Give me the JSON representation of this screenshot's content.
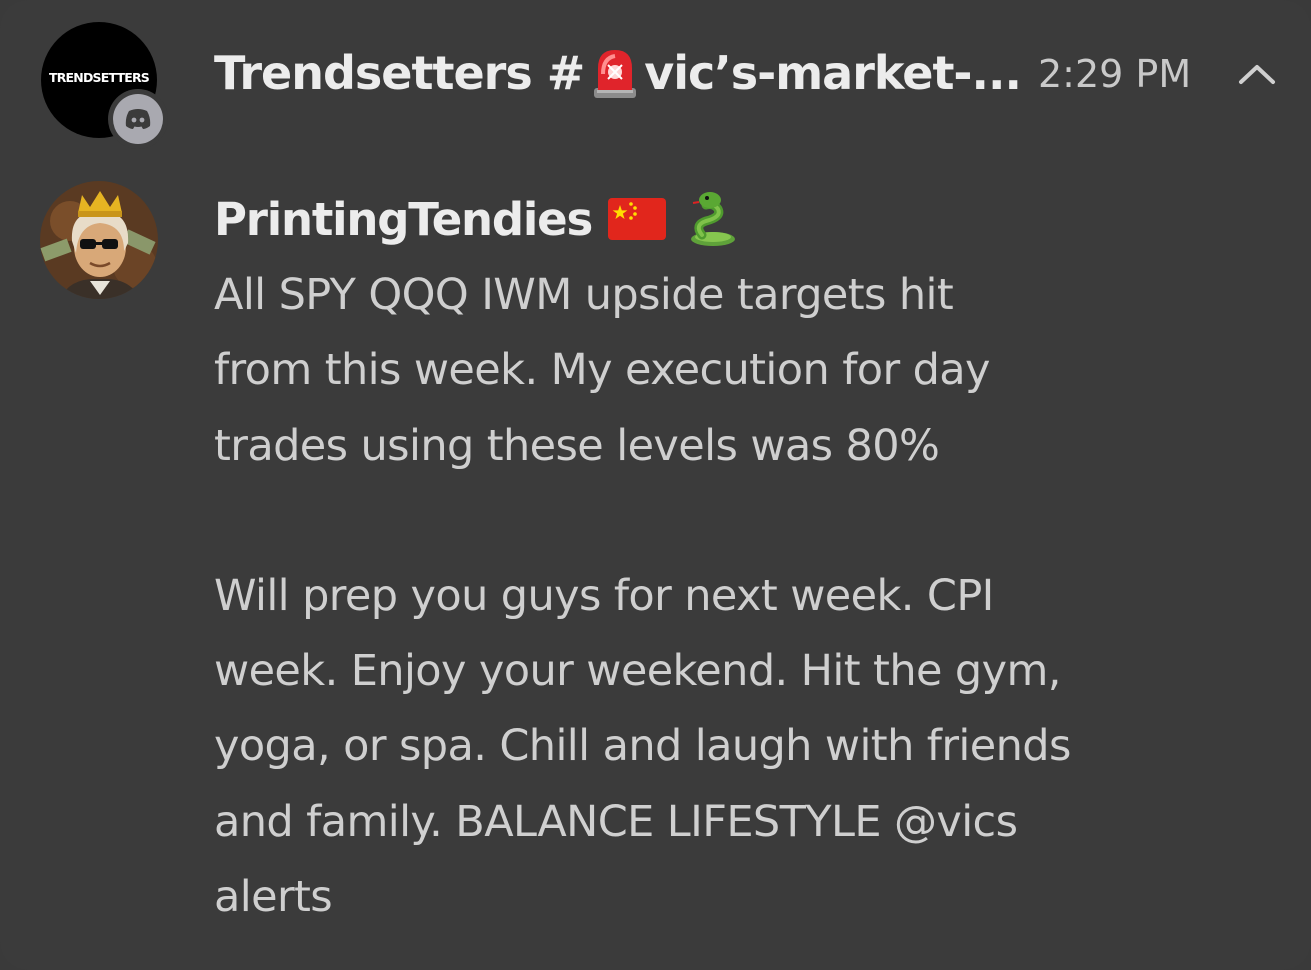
{
  "header": {
    "server_logo_text": "TRENDSETTERS",
    "server_name": "Trendsetters #",
    "channel_name": "vic’s-market-...",
    "time": "2:29 PM",
    "channel_emoji_icon": "rotating-light-icon",
    "app_badge_icon": "discord-icon",
    "collapse_icon": "chevron-up-icon"
  },
  "message": {
    "author": "PrintingTendies",
    "author_badges": [
      "china-flag-icon",
      "snake-icon"
    ],
    "paragraphs": [
      "All SPY QQQ IWM upside targets hit\nfrom this week. My execution for day\ntrades using these levels was 80%",
      "Will prep you guys for next week. CPI\nweek. Enjoy your weekend. Hit the gym,\nyoga, or spa. Chill and laugh with friends\nand family. BALANCE LIFESTYLE @vics\nalerts"
    ]
  },
  "colors": {
    "background": "#3b3b3b",
    "title_text": "#ececec",
    "body_text": "#cfcfcf",
    "time_text": "#c9c9c9",
    "badge": "#a9a9b0"
  }
}
